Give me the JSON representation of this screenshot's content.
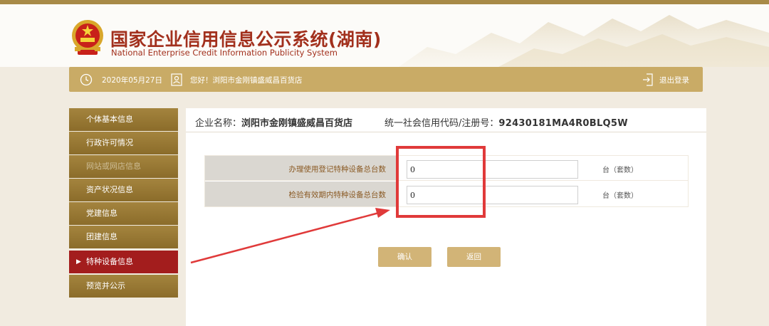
{
  "header": {
    "title_cn": "国家企业信用信息公示系统(湖南)",
    "title_en": "National Enterprise Credit Information Publicity System"
  },
  "infobar": {
    "date": "2020年05月27日",
    "greeting": "您好！浏阳市金刚镇盛威昌百货店",
    "logout": "退出登录"
  },
  "sidebar": {
    "items": [
      {
        "label": "个体基本信息"
      },
      {
        "label": "行政许可情况"
      },
      {
        "label": "网站或网店信息"
      },
      {
        "label": "资产状况信息"
      },
      {
        "label": "党建信息"
      },
      {
        "label": "团建信息"
      },
      {
        "label": "特种设备信息",
        "active": true
      },
      {
        "label": "预览并公示"
      }
    ]
  },
  "main": {
    "enterprise_label": "企业名称：",
    "enterprise_name": "浏阳市金刚镇盛威昌百货店",
    "code_label": "统一社会信用代码/注册号：",
    "code_value": "92430181MA4R0BLQ5W",
    "form": [
      {
        "label": "办理使用登记特种设备总台数",
        "value": "0",
        "unit": "台（套数）"
      },
      {
        "label": "检验有效期内特种设备总台数",
        "value": "0",
        "unit": "台（套数）"
      }
    ],
    "confirm_label": "确认",
    "back_label": "返回"
  },
  "colors": {
    "brand_gold": "#c9ab66",
    "title_red": "#a2301d",
    "active_red": "#a31d1d",
    "annotation_red": "#e03a3a"
  },
  "icons": [
    "national-emblem-icon",
    "clock-icon",
    "user-id-icon",
    "logout-icon"
  ]
}
